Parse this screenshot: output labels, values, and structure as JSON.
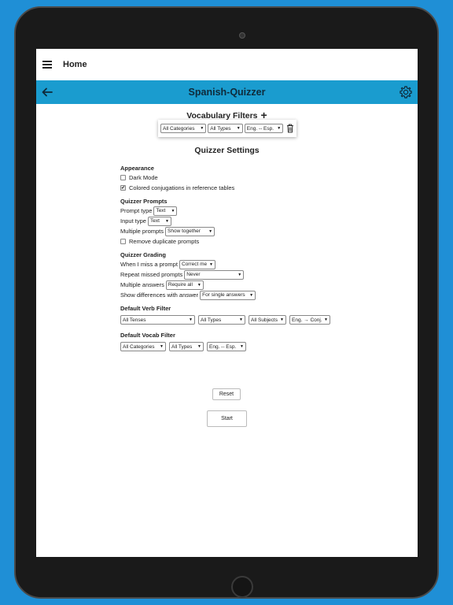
{
  "topbar": {
    "title": "Home"
  },
  "appbar": {
    "title": "Spanish-Quizzer"
  },
  "vocab_filters": {
    "title": "Vocabulary Filters",
    "category": "All Categories",
    "type": "All Types",
    "direction": "Eng. -- Esp."
  },
  "quizzer_settings": {
    "title": "Quizzer Settings",
    "appearance": {
      "heading": "Appearance",
      "dark_mode": "Dark Mode",
      "colored_conjugations": "Colored conjugations in reference tables"
    },
    "prompts": {
      "heading": "Quizzer Prompts",
      "prompt_type_label": "Prompt type",
      "prompt_type_value": "Text",
      "input_type_label": "Input type",
      "input_type_value": "Text",
      "multiple_prompts_label": "Multiple prompts",
      "multiple_prompts_value": "Show together",
      "remove_duplicates": "Remove duplicate prompts"
    },
    "grading": {
      "heading": "Quizzer Grading",
      "miss_label": "When I miss a prompt",
      "miss_value": "Correct me",
      "repeat_label": "Repeat missed prompts",
      "repeat_value": "Never",
      "multiple_answers_label": "Multiple answers",
      "multiple_answers_value": "Require all",
      "differences_label": "Show differences with answer",
      "differences_value": "For single answers"
    },
    "verb_filter": {
      "heading": "Default Verb Filter",
      "tenses": "All Tenses",
      "types": "All Types",
      "subjects": "All Subjects",
      "direction": "Eng. → Conj."
    },
    "vocab_filter": {
      "heading": "Default Vocab Filter",
      "categories": "All Categories",
      "types": "All Types",
      "direction": "Eng. -- Esp."
    },
    "reset_label": "Reset",
    "start_label": "Start"
  },
  "colors": {
    "background": "#1f8fd6",
    "appbar": "#1a9ccf"
  }
}
